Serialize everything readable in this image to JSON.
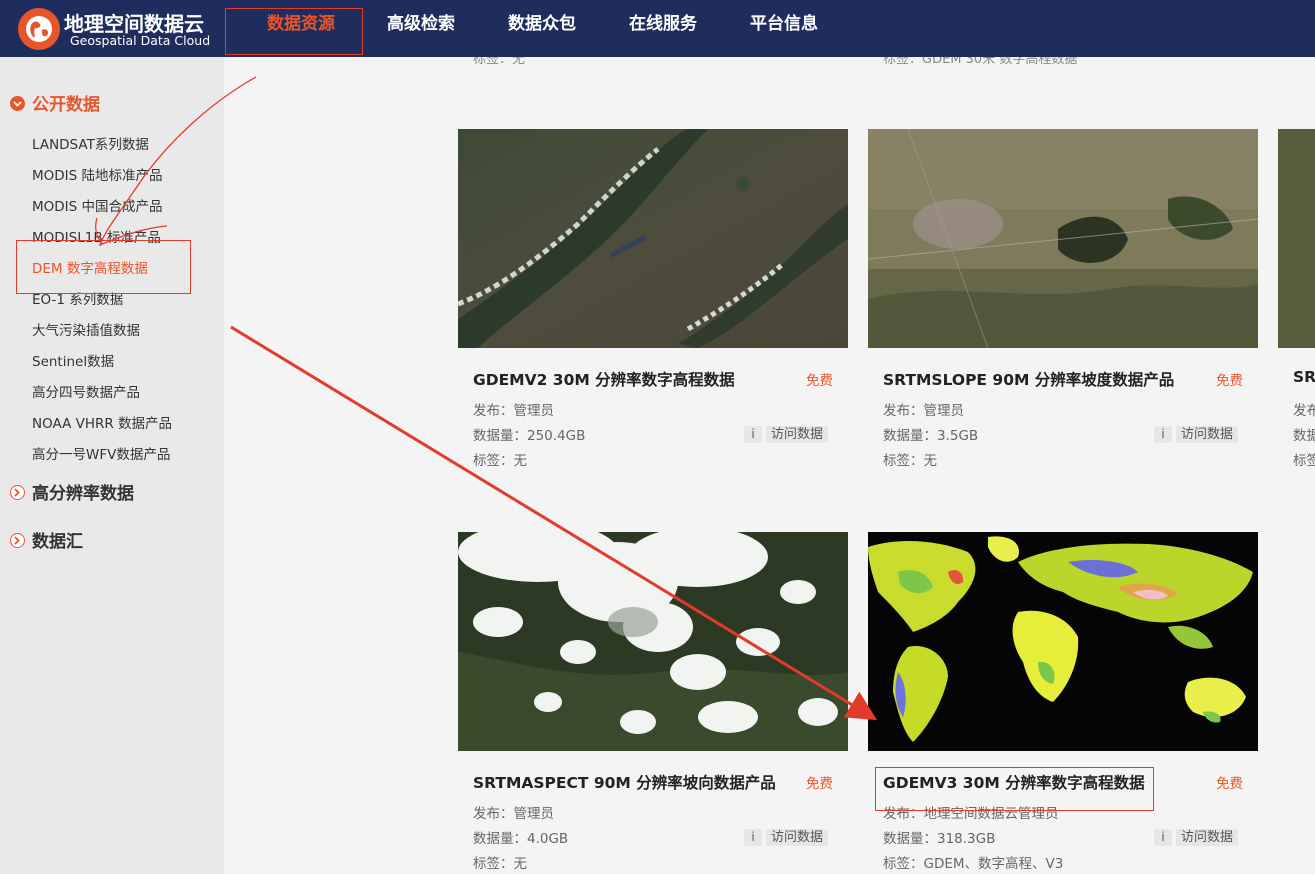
{
  "brand": {
    "name_cn": "地理空间数据云",
    "name_en": "Geospatial Data Cloud"
  },
  "nav": {
    "items": [
      "数据资源",
      "高级检索",
      "数据众包",
      "在线服务",
      "平台信息"
    ],
    "active": "数据资源"
  },
  "sidebar": {
    "categories": [
      {
        "label": "公开数据",
        "expanded": true,
        "items": [
          "LANDSAT系列数据",
          "MODIS 陆地标准产品",
          "MODIS 中国合成产品",
          "MODISL1B 标准产品",
          "DEM 数字高程数据",
          "EO-1 系列数据",
          "大气污染插值数据",
          "Sentinel数据",
          "高分四号数据产品",
          "NOAA VHRR 数据产品",
          "高分一号WFV数据产品"
        ],
        "selected": "DEM 数字高程数据"
      },
      {
        "label": "高分辨率数据",
        "expanded": false
      },
      {
        "label": "数据汇",
        "expanded": false
      }
    ]
  },
  "ghost_row": [
    "标签：无",
    "标签：GDEM 30米 数字高程数据"
  ],
  "cards": [
    {
      "title": "GDEMV2 30M 分辨率数字高程数据",
      "badge": "免费",
      "publisher": "发布：管理员",
      "size": "数据量：250.4GB",
      "tags": "标签：无",
      "info_label": "i",
      "visit_label": "访问数据",
      "thumb": "satellite-mountain-ridges"
    },
    {
      "title": "SRTMSLOPE 90M 分辨率坡度数据产品",
      "badge": "免费",
      "publisher": "发布：管理员",
      "size": "数据量：3.5GB",
      "tags": "标签：无",
      "info_label": "i",
      "visit_label": "访问数据",
      "thumb": "satellite-farmland"
    },
    {
      "title": "SRTMASPECT 90M 分辨率坡向数据产品",
      "badge": "免费",
      "publisher": "发布：管理员",
      "size": "数据量：4.0GB",
      "tags": "标签：无",
      "info_label": "i",
      "visit_label": "访问数据",
      "thumb": "satellite-clouds-forest"
    },
    {
      "title": "GDEMV3 30M 分辨率数字高程数据",
      "badge": "免费",
      "publisher": "发布：地理空间数据云管理员",
      "size": "数据量：318.3GB",
      "tags": "标签：GDEM、数字高程、V3",
      "info_label": "i",
      "visit_label": "访问数据",
      "thumb": "world-elevation-map"
    }
  ],
  "partial_card": {
    "title": "SRT",
    "publisher": "发布",
    "size": "数据",
    "tags": "标签"
  },
  "colors": {
    "nav_bg": "#1f2d5e",
    "accent": "#e8552a",
    "annotation": "#e23a2b",
    "sidebar_bg": "#e9e9e9"
  }
}
